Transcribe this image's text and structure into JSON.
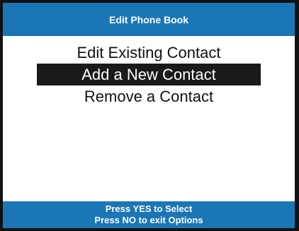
{
  "header": {
    "title": "Edit Phone Book"
  },
  "menu": {
    "items": [
      {
        "label": "Edit Existing Contact",
        "selected": false
      },
      {
        "label": "Add a New Contact",
        "selected": true
      },
      {
        "label": "Remove a Contact",
        "selected": false
      }
    ]
  },
  "footer": {
    "line1": "Press YES to Select",
    "line2": "Press NO to exit Options"
  },
  "colors": {
    "accent": "#1b76b6",
    "selection": "#1a1a1a",
    "frame": "#111111"
  }
}
